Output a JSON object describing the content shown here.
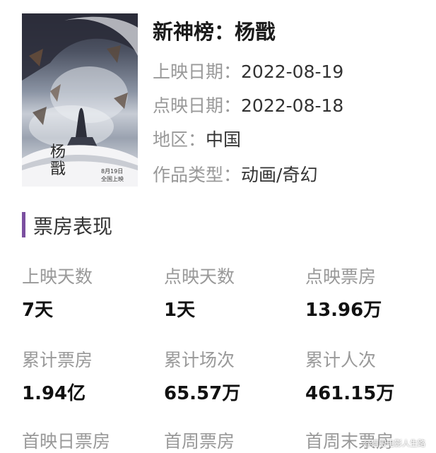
{
  "movie": {
    "title": "新神榜：杨戬",
    "release_date_label": "上映日期：",
    "release_date": "2022-08-19",
    "preview_date_label": "点映日期：",
    "preview_date": "2022-08-18",
    "region_label": "地区：",
    "region": "中国",
    "genre_label": "作品类型：",
    "genre": "动画/奇幻"
  },
  "poster": {
    "title_text": "杨戬",
    "date_text": "8月19日",
    "release_text": "全国上映"
  },
  "box_office": {
    "section_title": "票房表现",
    "stats": [
      {
        "label": "上映天数",
        "value": "7天"
      },
      {
        "label": "点映天数",
        "value": "1天"
      },
      {
        "label": "点映票房",
        "value": "13.96万"
      },
      {
        "label": "累计票房",
        "value": "1.94亿"
      },
      {
        "label": "累计场次",
        "value": "65.57万"
      },
      {
        "label": "累计人次",
        "value": "461.15万"
      },
      {
        "label": "首映日票房",
        "value": ""
      },
      {
        "label": "首周票房",
        "value": ""
      },
      {
        "label": "首周末票房",
        "value": ""
      }
    ]
  },
  "watermark": "@猫眼电影人生路",
  "colors": {
    "accent": "#7b4fa0",
    "label_gray": "#999999",
    "value_dark": "#111111"
  }
}
